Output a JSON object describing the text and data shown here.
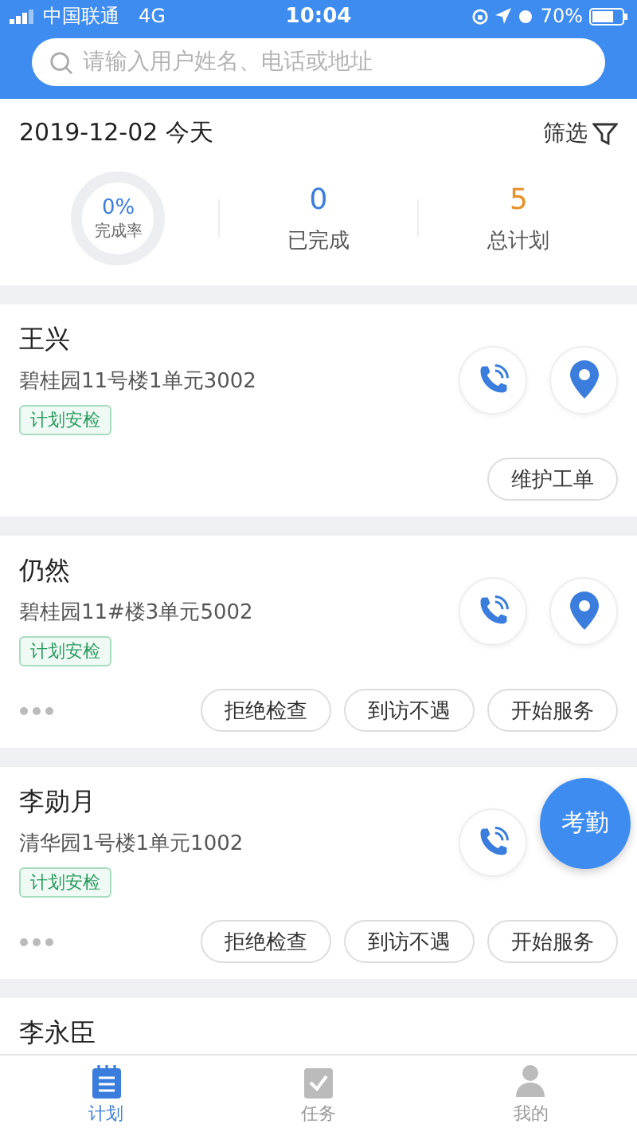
{
  "status_bar": {
    "carrier": "中国联通",
    "network": "4G",
    "time": "10:04",
    "battery": "70%"
  },
  "search": {
    "placeholder": "请输入用户姓名、电话或地址"
  },
  "header": {
    "date": "2019-12-02 今天",
    "filter": "筛选"
  },
  "summary": {
    "rate": "0%",
    "rate_label": "完成率",
    "level": 0,
    "stats": [
      {
        "value": "0",
        "label": "已完成",
        "color": "#3b7ddd"
      },
      {
        "value": "5",
        "label": "总计划",
        "color": "#e8912a"
      }
    ]
  },
  "cards": [
    {
      "name": "王兴",
      "address": "碧桂园11号楼1单元3002",
      "tag": "计划安检",
      "kind": "full",
      "more": false,
      "location": true,
      "buttons": [
        "维护工单"
      ]
    },
    {
      "name": "仍然",
      "address": "碧桂园11#楼3单元5002",
      "tag": "计划安检",
      "kind": "full",
      "more": true,
      "location": true,
      "buttons": [
        "拒绝检查",
        "到访不遇",
        "开始服务"
      ]
    },
    {
      "name": "李勋月",
      "address": "清华园1号楼1单元1002",
      "tag": "计划安检",
      "kind": "full",
      "more": true,
      "location": false,
      "buttons": [
        "拒绝检查",
        "到访不遇",
        "开始服务"
      ]
    },
    {
      "name": "李永臣",
      "kind": "cut"
    }
  ],
  "fab": "考勤",
  "tabs": [
    {
      "label": "计划",
      "selected": true
    },
    {
      "label": "任务",
      "selected": false
    },
    {
      "label": "我的",
      "selected": false
    }
  ]
}
